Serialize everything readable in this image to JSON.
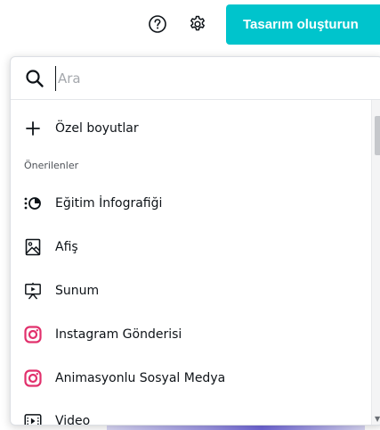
{
  "topbar": {
    "help_icon": "help-circle-icon",
    "settings_icon": "gear-icon",
    "create_button_label": "Tasarım oluşturun"
  },
  "popup": {
    "search": {
      "placeholder": "Ara",
      "icon": "search-icon"
    },
    "custom_size": {
      "icon": "plus-icon",
      "label": "Özel boyutlar"
    },
    "section_title": "Önerilenler",
    "items": [
      {
        "label": "Eğitim İnfografiği",
        "icon": "infographic-icon"
      },
      {
        "label": "Afiş",
        "icon": "poster-icon"
      },
      {
        "label": "Sunum",
        "icon": "presentation-icon"
      },
      {
        "label": "Instagram Gönderisi",
        "icon": "instagram-icon"
      },
      {
        "label": "Animasyonlu Sosyal Medya",
        "icon": "instagram-icon"
      },
      {
        "label": "Video",
        "icon": "video-icon"
      }
    ]
  },
  "colors": {
    "accent": "#00c4cc",
    "instagram": "#e1306c",
    "text": "#0e1318"
  }
}
